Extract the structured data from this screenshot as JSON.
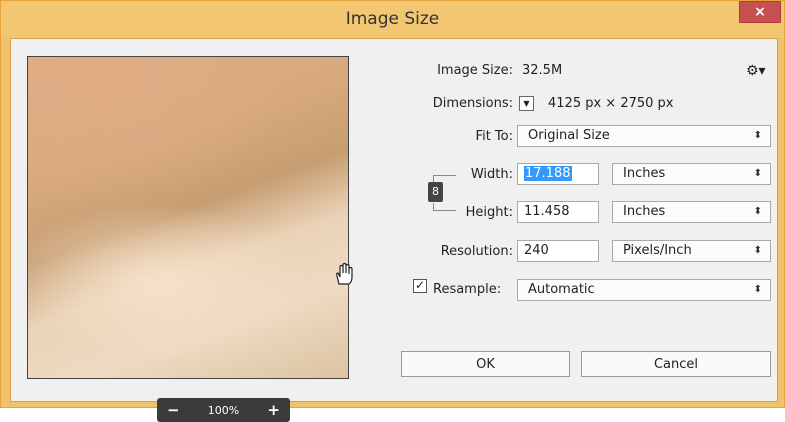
{
  "window": {
    "title": "Image Size",
    "close_label": "×"
  },
  "preview": {
    "zoom_level": "100%",
    "zoom_out_label": "−",
    "zoom_in_label": "+"
  },
  "image_size": {
    "label": "Image Size:",
    "value": "32.5M"
  },
  "dimensions": {
    "label": "Dimensions:",
    "value": "4125 px  ×  2750 px"
  },
  "fit_to": {
    "label": "Fit To:",
    "value": "Original Size"
  },
  "width": {
    "label": "Width:",
    "value": "17.188",
    "unit": "Inches"
  },
  "height": {
    "label": "Height:",
    "value": "11.458",
    "unit": "Inches"
  },
  "resolution": {
    "label": "Resolution:",
    "value": "240",
    "unit": "Pixels/Inch"
  },
  "resample": {
    "label": "Resample:",
    "checked": true,
    "value": "Automatic"
  },
  "buttons": {
    "ok": "OK",
    "cancel": "Cancel"
  },
  "icons": {
    "gear": "gear-icon",
    "chain": "chain-link-icon",
    "hand": "hand-cursor-icon"
  },
  "colors": {
    "title_bar": "#f3c772",
    "close_button": "#c75050",
    "selection": "#3399ff"
  }
}
